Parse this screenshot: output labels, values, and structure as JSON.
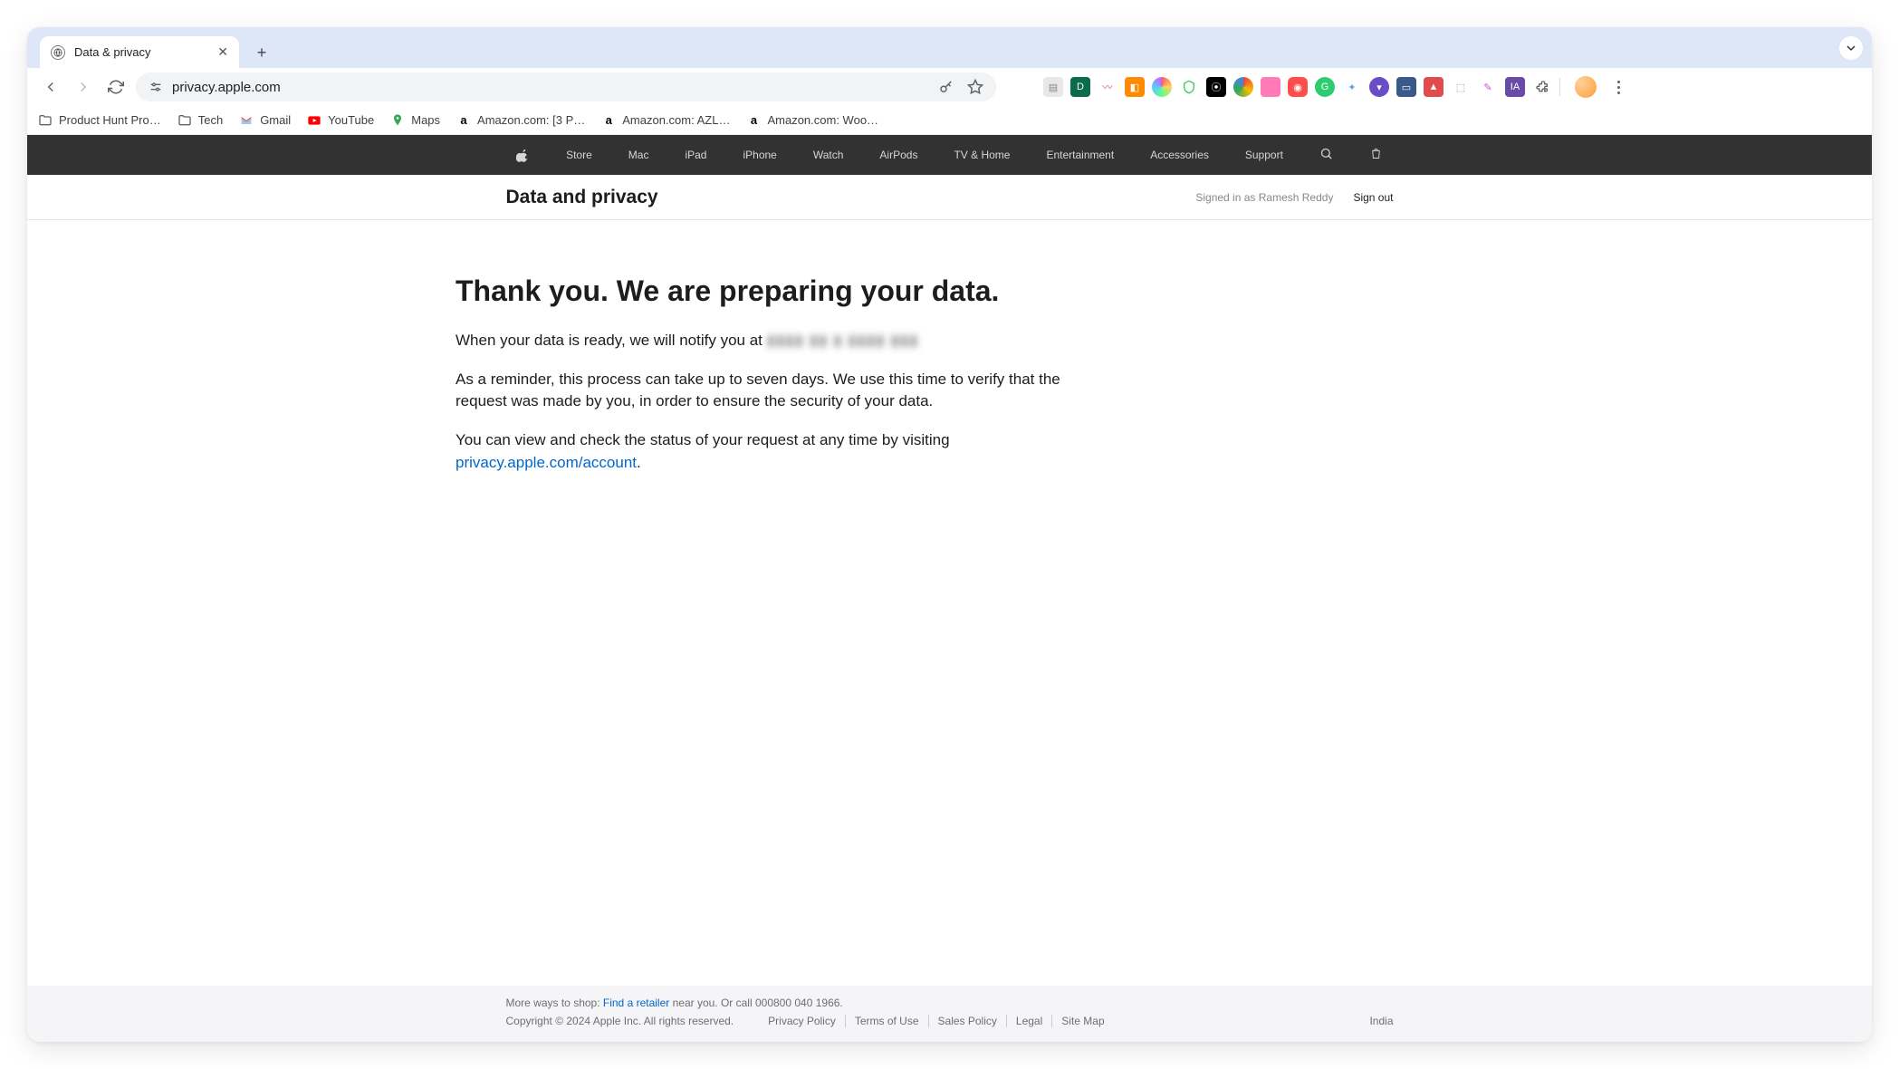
{
  "browser": {
    "tab_title": "Data & privacy",
    "url": "privacy.apple.com",
    "bookmarks": [
      {
        "label": "Product Hunt Pro…",
        "type": "folder"
      },
      {
        "label": "Tech",
        "type": "folder"
      },
      {
        "label": "Gmail",
        "type": "gmail"
      },
      {
        "label": "YouTube",
        "type": "youtube"
      },
      {
        "label": "Maps",
        "type": "maps"
      },
      {
        "label": "Amazon.com: [3 P…",
        "type": "amazon"
      },
      {
        "label": "Amazon.com: AZL…",
        "type": "amazon"
      },
      {
        "label": "Amazon.com: Woo…",
        "type": "amazon"
      }
    ]
  },
  "apple_nav": {
    "items": [
      "Store",
      "Mac",
      "iPad",
      "iPhone",
      "Watch",
      "AirPods",
      "TV & Home",
      "Entertainment",
      "Accessories",
      "Support"
    ]
  },
  "sub_header": {
    "title": "Data and privacy",
    "signed_in_as": "Signed in as Ramesh Reddy",
    "sign_out": "Sign out"
  },
  "content": {
    "heading": "Thank you. We are preparing your data.",
    "notify_prefix": "When your data is ready, we will notify you at ",
    "notify_email_redacted": "▮▮▮▮ ▮▮ ▮ ▮▮▮▮ ▮▮▮",
    "reminder": "As a reminder, this process can take up to seven days. We use this time to verify that the request was made by you, in order to ensure the security of your data.",
    "status_prefix": "You can view and check the status of your request at any time by visiting ",
    "status_link_text": "privacy.apple.com/account",
    "status_suffix": "."
  },
  "footer": {
    "shop_prefix": "More ways to shop: ",
    "shop_link": "Find a retailer",
    "shop_mid": " near you. Or call ",
    "shop_phone": "000800 040 1966.",
    "copyright": "Copyright © 2024 Apple Inc. All rights reserved.",
    "links": [
      "Privacy Policy",
      "Terms of Use",
      "Sales Policy",
      "Legal",
      "Site Map"
    ],
    "region": "India"
  }
}
